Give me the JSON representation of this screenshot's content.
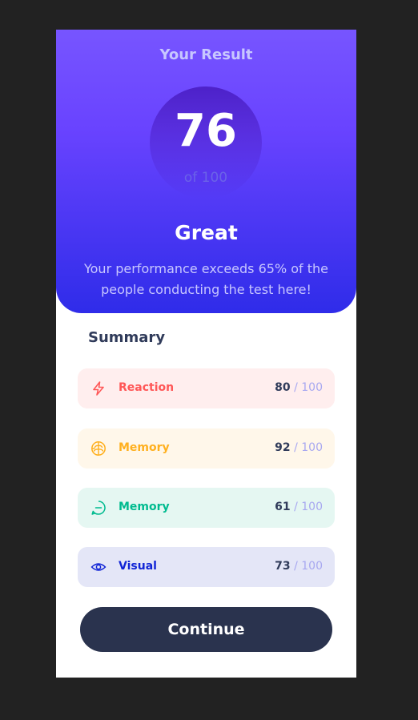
{
  "result": {
    "title": "Your Result",
    "score": "76",
    "max_label": "of 100",
    "grade": "Great",
    "description": "Your performance exceeds 65% of the people conducting the test here!"
  },
  "summary": {
    "title": "Summary",
    "items": [
      {
        "label": "Reaction",
        "value": "80",
        "max": "/ 100",
        "icon": "lightning-icon",
        "color": "#FF5757",
        "background": "#FFEEEE"
      },
      {
        "label": "Memory",
        "value": "92",
        "max": "/ 100",
        "icon": "brain-icon",
        "color": "#FFB01F",
        "background": "#FFF7EA"
      },
      {
        "label": "Memory",
        "value": "61",
        "max": "/ 100",
        "icon": "chat-icon",
        "color": "#00BB8F",
        "background": "#E5F7F2"
      },
      {
        "label": "Visual",
        "value": "73",
        "max": "/ 100",
        "icon": "eye-icon",
        "color": "#1125D6",
        "background": "#E4E6F7"
      }
    ]
  },
  "actions": {
    "continue_label": "Continue"
  },
  "colors": {
    "gradient_top": "#7755FF",
    "gradient_bottom": "#2F2CE9",
    "button": "#2A334E",
    "page_background": "#222222"
  }
}
